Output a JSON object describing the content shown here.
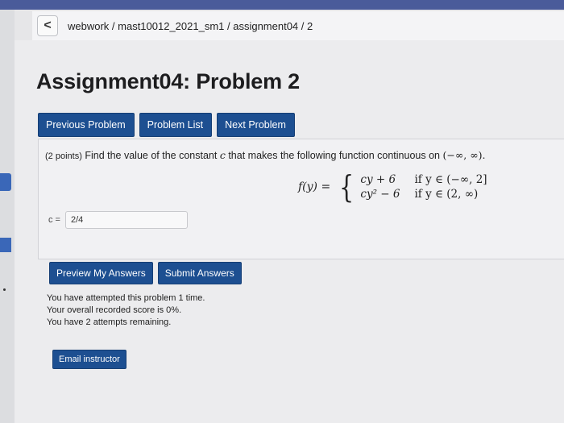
{
  "breadcrumb": {
    "back_icon": "chevron-left-icon",
    "back_label": "<",
    "path": "webwork / mast10012_2021_sm1 / assignment04 / 2"
  },
  "title": "Assignment04: Problem 2",
  "nav": {
    "previous": "Previous Problem",
    "list": "Problem List",
    "next": "Next Problem"
  },
  "problem": {
    "points": "(2 points)",
    "text_before": "Find the value of the constant",
    "constant": "c",
    "text_after": "that makes the following function continuous on",
    "interval": "(−∞, ∞).",
    "function_lhs": "f(y) =",
    "cases": [
      {
        "expr": "cy + 6",
        "cond": "if y ∈ (−∞, 2]"
      },
      {
        "expr": "cy² − 6",
        "cond": "if y ∈ (2, ∞)"
      }
    ],
    "answer_label": "c =",
    "answer_value": "2/4"
  },
  "buttons": {
    "preview": "Preview My Answers",
    "submit": "Submit Answers",
    "email": "Email instructor"
  },
  "status": {
    "attempted": "You have attempted this problem 1 time.",
    "score": "Your overall recorded score is 0%.",
    "remaining": "You have 2 attempts remaining."
  },
  "colors": {
    "button_bg": "#1d4f91",
    "top_strip": "#4a5b9a"
  }
}
